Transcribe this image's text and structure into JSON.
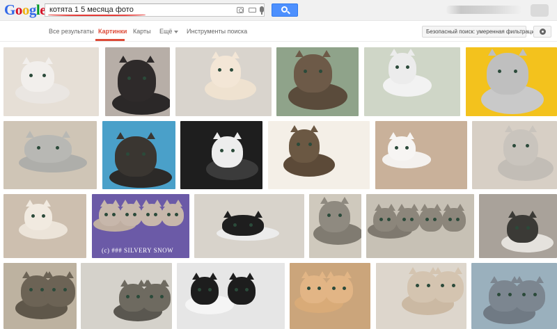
{
  "logo": {
    "letters": [
      "G",
      "o",
      "o",
      "g",
      "l",
      "e"
    ],
    "colors": [
      "#3369e8",
      "#d50f25",
      "#eeb211",
      "#3369e8",
      "#009925",
      "#d50f25"
    ]
  },
  "search": {
    "query": "котята 1 5 месяца фото"
  },
  "tabs": [
    {
      "label": "Все результаты",
      "active": false
    },
    {
      "label": "Картинки",
      "active": true
    },
    {
      "label": "Карты",
      "active": false
    },
    {
      "label": "Ещё",
      "active": false,
      "dropdown": true
    },
    {
      "label": "Инструменты поиска",
      "active": false
    }
  ],
  "safe_search": {
    "label": "Безопасный поиск: умеренная фильтрация"
  },
  "icons": {
    "camera": "camera-icon",
    "keyboard": "keyboard-icon",
    "mic": "microphone-icon",
    "search": "search-icon",
    "gear": "gear-icon"
  },
  "accent_colors": {
    "active_tab": "#dd4b39",
    "search_button": "#4d90fe"
  },
  "results": [
    {
      "row": 1,
      "watermark": ""
    },
    {
      "row": 1,
      "watermark": ""
    },
    {
      "row": 1,
      "watermark": ""
    },
    {
      "row": 1,
      "watermark": ""
    },
    {
      "row": 1,
      "watermark": ""
    },
    {
      "row": 1,
      "watermark": ""
    },
    {
      "row": 2,
      "watermark": ""
    },
    {
      "row": 2,
      "watermark": ""
    },
    {
      "row": 2,
      "watermark": ""
    },
    {
      "row": 2,
      "watermark": ""
    },
    {
      "row": 2,
      "watermark": ""
    },
    {
      "row": 2,
      "watermark": ""
    },
    {
      "row": 3,
      "watermark": ""
    },
    {
      "row": 3,
      "watermark": "(c) ### SILVERY SNOW"
    },
    {
      "row": 3,
      "watermark": ""
    },
    {
      "row": 3,
      "watermark": ""
    },
    {
      "row": 3,
      "watermark": ""
    },
    {
      "row": 3,
      "watermark": ""
    },
    {
      "row": 4,
      "watermark": ""
    },
    {
      "row": 4,
      "watermark": ""
    },
    {
      "row": 4,
      "watermark": ""
    },
    {
      "row": 4,
      "watermark": ""
    },
    {
      "row": 4,
      "watermark": ""
    },
    {
      "row": 4,
      "watermark": ""
    }
  ]
}
